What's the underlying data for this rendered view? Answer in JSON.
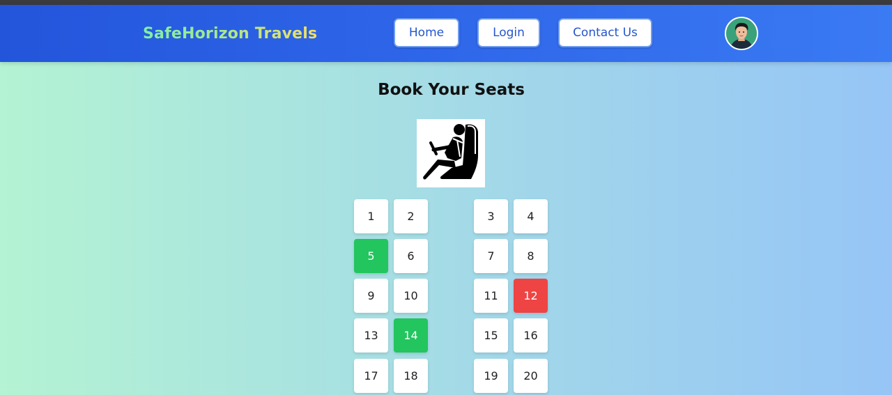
{
  "brand": "SafeHorizon Travels",
  "nav": {
    "home": "Home",
    "login": "Login",
    "contact": "Contact Us"
  },
  "page_title": "Book Your Seats",
  "colors": {
    "selected": "#22c55e",
    "booked": "#ef4444",
    "available": "#ffffff",
    "header": "#2f67ea"
  },
  "seats": [
    {
      "number": "1",
      "status": "available"
    },
    {
      "number": "2",
      "status": "available"
    },
    {
      "number": "3",
      "status": "available"
    },
    {
      "number": "4",
      "status": "available"
    },
    {
      "number": "5",
      "status": "selected"
    },
    {
      "number": "6",
      "status": "available"
    },
    {
      "number": "7",
      "status": "available"
    },
    {
      "number": "8",
      "status": "available"
    },
    {
      "number": "9",
      "status": "available"
    },
    {
      "number": "10",
      "status": "available"
    },
    {
      "number": "11",
      "status": "available"
    },
    {
      "number": "12",
      "status": "booked"
    },
    {
      "number": "13",
      "status": "available"
    },
    {
      "number": "14",
      "status": "selected"
    },
    {
      "number": "15",
      "status": "available"
    },
    {
      "number": "16",
      "status": "available"
    },
    {
      "number": "17",
      "status": "available"
    },
    {
      "number": "18",
      "status": "available"
    },
    {
      "number": "19",
      "status": "available"
    },
    {
      "number": "20",
      "status": "available"
    }
  ],
  "icons": {
    "avatar": "user-avatar",
    "driver": "driver-seat-icon"
  }
}
